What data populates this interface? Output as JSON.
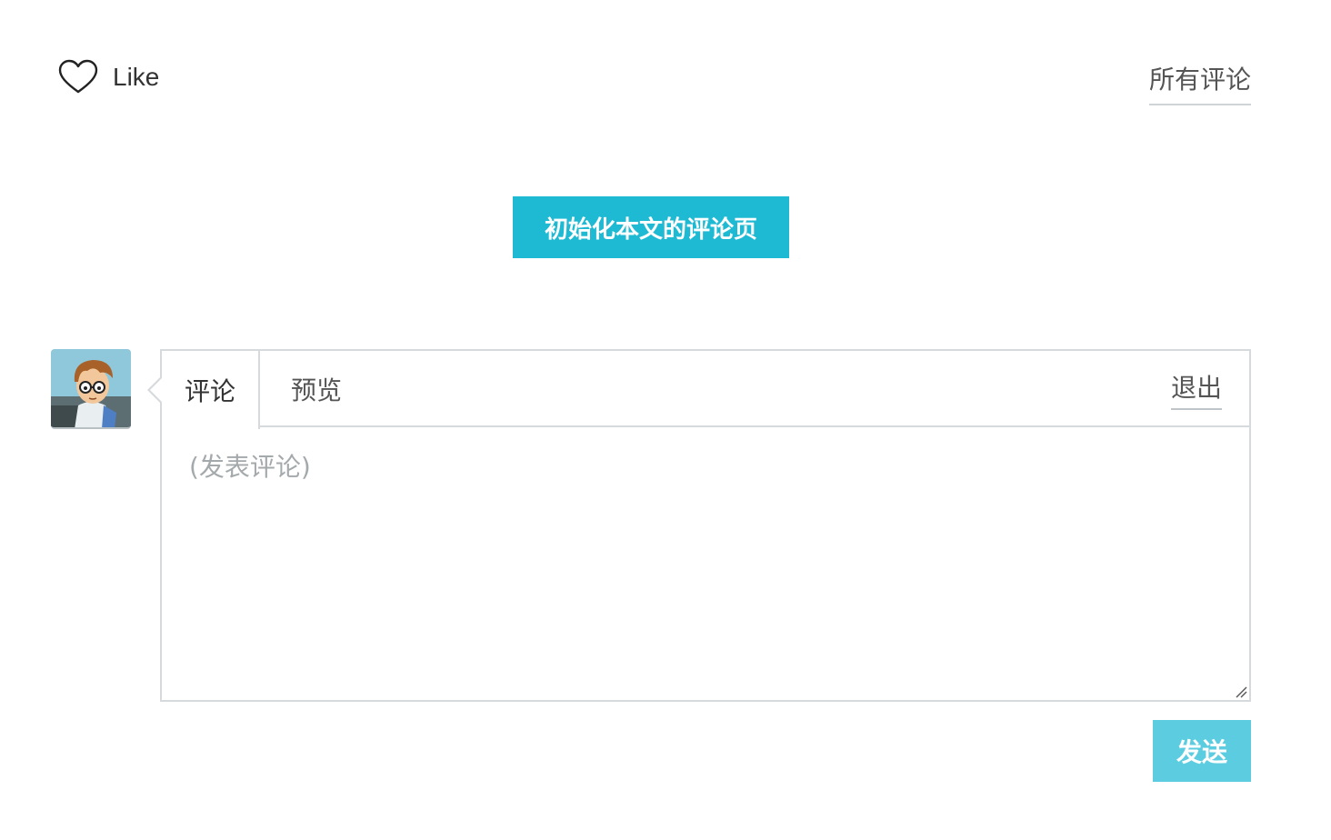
{
  "header": {
    "like_label": "Like",
    "all_comments_label": "所有评论"
  },
  "init_button_label": "初始化本文的评论页",
  "editor": {
    "tabs": {
      "comment": "评论",
      "preview": "预览",
      "exit": "退出"
    },
    "placeholder": "(发表评论)"
  },
  "send_button_label": "发送",
  "colors": {
    "accent": "#1eb9d2",
    "send_button": "#5ccde0",
    "border": "#d6dadc"
  }
}
